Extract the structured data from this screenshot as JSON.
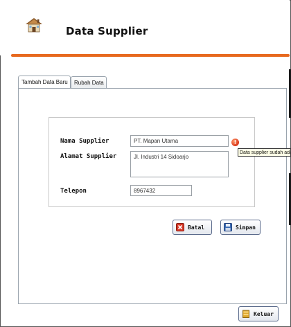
{
  "header": {
    "title": "Data Supplier",
    "icon": "house-icon"
  },
  "tabs": [
    {
      "label": "Tambah Data Baru",
      "active": true
    },
    {
      "label": "Rubah Data",
      "active": false
    }
  ],
  "form": {
    "nama_supplier": {
      "label": "Nama Supplier",
      "value": "PT. Mapan Utama"
    },
    "alamat_supplier": {
      "label": "Alamat Supplier",
      "value": "Jl. Industri 14 Sidoarjo"
    },
    "telepon": {
      "label": "Telepon",
      "value": "8967432"
    }
  },
  "validation": {
    "icon": "error-icon",
    "tooltip": "Data supplier sudah ada"
  },
  "buttons": {
    "batal": {
      "label": "Batal",
      "icon": "cancel-icon"
    },
    "simpan": {
      "label": "Simpan",
      "icon": "save-icon"
    },
    "keluar": {
      "label": "Keluar",
      "icon": "exit-icon"
    }
  },
  "colors": {
    "accent_line": "#e7691f",
    "error": "#d9361a",
    "tooltip_bg": "#ffffe6"
  }
}
